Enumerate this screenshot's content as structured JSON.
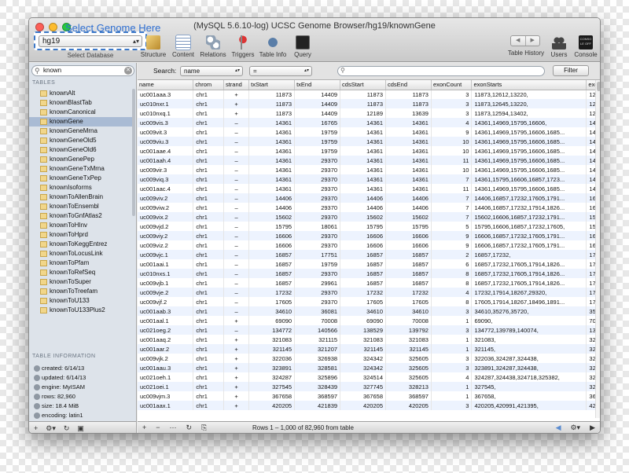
{
  "window": {
    "title": "(MySQL 5.6.10-log) UCSC Genome Browser/hg19/knownGene"
  },
  "database": {
    "heading": "Select Genome Here",
    "selected": "hg19",
    "label": "Select Database"
  },
  "toolbar": {
    "structure": "Structure",
    "content": "Content",
    "relations": "Relations",
    "triggers": "Triggers",
    "table_info": "Table Info",
    "query": "Query",
    "table_history": "Table History",
    "users": "Users",
    "console": "Console",
    "console_icon_text": "CONSO LE OFF"
  },
  "sidebar": {
    "filter_value": "known",
    "tables_header": "TABLES",
    "tables": [
      "knownAlt",
      "knownBlastTab",
      "knownCanonical",
      "knownGene",
      "knownGeneMrna",
      "knownGeneOld5",
      "knownGeneOld6",
      "knownGenePep",
      "knownGeneTxMrna",
      "knownGeneTxPep",
      "knownIsoforms",
      "knownToAllenBrain",
      "knownToEnsembl",
      "knownToGnfAtlas2",
      "knownToHInv",
      "knownToHprd",
      "knownToKeggEntrez",
      "knownToLocusLink",
      "knownToPfam",
      "knownToRefSeq",
      "knownToSuper",
      "knownToTreefam",
      "knownToU133",
      "knownToU133Plus2"
    ],
    "selected_index": 3,
    "info_header": "TABLE INFORMATION",
    "info": [
      "created: 6/14/13",
      "updated: 6/14/13",
      "engine: MyISAM",
      "rows: 82,960",
      "size: 18.4 MiB",
      "encoding: latin1"
    ]
  },
  "search": {
    "label": "Search:",
    "field": "name",
    "operator": "=",
    "value": "",
    "filter_button": "Filter"
  },
  "grid": {
    "columns": [
      "name",
      "chrom",
      "strand",
      "txStart",
      "txEnd",
      "cdsStart",
      "cdsEnd",
      "exonCount",
      "exonStarts",
      "exonEnds"
    ],
    "rows": [
      [
        "uc001aaa.3",
        "chr1",
        "+",
        "11873",
        "14409",
        "11873",
        "11873",
        "3",
        "11873,12612,13220,",
        "12227,1272"
      ],
      [
        "uc010nxr.1",
        "chr1",
        "+",
        "11873",
        "14409",
        "11873",
        "11873",
        "3",
        "11873,12645,13220,",
        "12227,1269"
      ],
      [
        "uc010nxq.1",
        "chr1",
        "+",
        "11873",
        "14409",
        "12189",
        "13639",
        "3",
        "11873,12594,13402,",
        "12227,1272"
      ],
      [
        "uc009vis.3",
        "chr1",
        "–",
        "14361",
        "16765",
        "14361",
        "14361",
        "4",
        "14361,14969,15795,16606,",
        "14829,1503"
      ],
      [
        "uc009vit.3",
        "chr1",
        "–",
        "14361",
        "19759",
        "14361",
        "14361",
        "9",
        "14361,14969,15795,16606,1685...",
        "14829,1503"
      ],
      [
        "uc009viu.3",
        "chr1",
        "–",
        "14361",
        "19759",
        "14361",
        "14361",
        "10",
        "14361,14969,15795,16606,1685...",
        "14829,1503"
      ],
      [
        "uc001aae.4",
        "chr1",
        "–",
        "14361",
        "19759",
        "14361",
        "14361",
        "10",
        "14361,14969,15795,16606,1685...",
        "14829,1503"
      ],
      [
        "uc001aah.4",
        "chr1",
        "–",
        "14361",
        "29370",
        "14361",
        "14361",
        "11",
        "14361,14969,15795,16606,1685...",
        "14829,1503"
      ],
      [
        "uc009vir.3",
        "chr1",
        "–",
        "14361",
        "29370",
        "14361",
        "14361",
        "10",
        "14361,14969,15795,16606,1685...",
        "14829,1503"
      ],
      [
        "uc009viq.3",
        "chr1",
        "–",
        "14361",
        "29370",
        "14361",
        "14361",
        "7",
        "14361,15795,16606,16857,1723...",
        "14829,1594"
      ],
      [
        "uc001aac.4",
        "chr1",
        "–",
        "14361",
        "29370",
        "14361",
        "14361",
        "11",
        "14361,14969,15795,16606,1685...",
        "14829,1503"
      ],
      [
        "uc009viv.2",
        "chr1",
        "–",
        "14406",
        "29370",
        "14406",
        "14406",
        "7",
        "14406,16857,17232,17605,1791...",
        "16765,1705"
      ],
      [
        "uc009viw.2",
        "chr1",
        "–",
        "14406",
        "29370",
        "14406",
        "14406",
        "7",
        "14406,16857,17232,17914,1826...",
        "16765,1705"
      ],
      [
        "uc009vix.2",
        "chr1",
        "–",
        "15602",
        "29370",
        "15602",
        "15602",
        "7",
        "15602,16606,16857,17232,1791...",
        "15947,1676"
      ],
      [
        "uc009vjd.2",
        "chr1",
        "–",
        "15795",
        "18061",
        "15795",
        "15795",
        "5",
        "15795,16606,16857,17232,17605,",
        "15947,1676"
      ],
      [
        "uc009viy.2",
        "chr1",
        "–",
        "16606",
        "29370",
        "16606",
        "16606",
        "9",
        "16606,16857,17232,17605,1791...",
        "16765,1705"
      ],
      [
        "uc009viz.2",
        "chr1",
        "–",
        "16606",
        "29370",
        "16606",
        "16606",
        "9",
        "16606,16857,17232,17605,1791...",
        "16765,1705"
      ],
      [
        "uc009vjc.1",
        "chr1",
        "–",
        "16857",
        "17751",
        "16857",
        "16857",
        "2",
        "16857,17232,",
        "17055,1775"
      ],
      [
        "uc001aai.1",
        "chr1",
        "–",
        "16857",
        "19759",
        "16857",
        "16857",
        "6",
        "16857,17232,17605,17914,1826...",
        "17055,1736"
      ],
      [
        "uc010nxs.1",
        "chr1",
        "–",
        "16857",
        "29370",
        "16857",
        "16857",
        "8",
        "16857,17232,17605,17914,1826...",
        "17055,1736"
      ],
      [
        "uc009vjb.1",
        "chr1",
        "–",
        "16857",
        "29961",
        "16857",
        "16857",
        "8",
        "16857,17232,17605,17914,1826...",
        "17055,1736"
      ],
      [
        "uc009vje.2",
        "chr1",
        "–",
        "17232",
        "29370",
        "17232",
        "17232",
        "4",
        "17232,17914,18267,29320,",
        "17742,1806"
      ],
      [
        "uc009vjf.2",
        "chr1",
        "–",
        "17605",
        "29370",
        "17605",
        "17605",
        "8",
        "17605,17914,18267,18496,1891...",
        "17742,1806"
      ],
      [
        "uc001aab.3",
        "chr1",
        "–",
        "34610",
        "36081",
        "34610",
        "34610",
        "3",
        "34610,35276,35720,",
        "35174,3548"
      ],
      [
        "uc001aal.1",
        "chr1",
        "+",
        "69090",
        "70008",
        "69090",
        "70008",
        "1",
        "69090,",
        "70008,"
      ],
      [
        "uc021oeg.2",
        "chr1",
        "–",
        "134772",
        "140566",
        "138529",
        "139792",
        "3",
        "134772,139789,140074,",
        "139696,139"
      ],
      [
        "uc001aaq.2",
        "chr1",
        "+",
        "321083",
        "321115",
        "321083",
        "321083",
        "1",
        "321083,",
        "321115,"
      ],
      [
        "uc001aar.2",
        "chr1",
        "+",
        "321145",
        "321207",
        "321145",
        "321145",
        "1",
        "321145,",
        "321207,"
      ],
      [
        "uc009vjk.2",
        "chr1",
        "+",
        "322036",
        "326938",
        "324342",
        "325605",
        "3",
        "322036,324287,324438,",
        "322228,324"
      ],
      [
        "uc001aau.3",
        "chr1",
        "+",
        "323891",
        "328581",
        "324342",
        "325605",
        "3",
        "323891,324287,324438,",
        "324060,324"
      ],
      [
        "uc021oeh.1",
        "chr1",
        "+",
        "324287",
        "325896",
        "324514",
        "325605",
        "4",
        "324287,324438,324718,325382,",
        "324345,324"
      ],
      [
        "uc021oei.1",
        "chr1",
        "+",
        "327545",
        "328439",
        "327745",
        "328213",
        "1",
        "327545,",
        "328439,"
      ],
      [
        "uc009vjm.3",
        "chr1",
        "+",
        "367658",
        "368597",
        "367658",
        "368597",
        "1",
        "367658,",
        "368597,"
      ],
      [
        "uc001aax.1",
        "chr1",
        "+",
        "420205",
        "421839",
        "420205",
        "420205",
        "3",
        "420205,420991,421395,",
        "420296,421"
      ]
    ]
  },
  "footer": {
    "status": "Rows 1 – 1,000 of 82,960 from table"
  }
}
